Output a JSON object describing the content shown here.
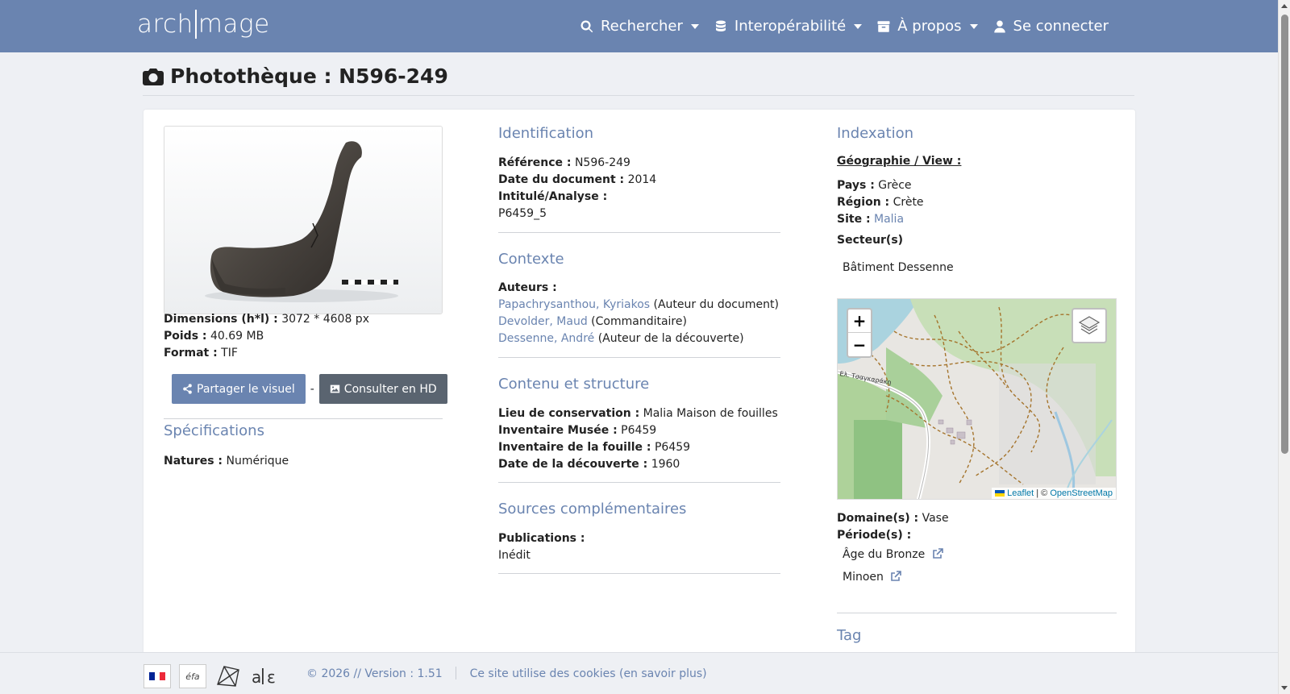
{
  "navbar": {
    "logo": "arch|mage",
    "logo_left": "arch",
    "logo_right": "mage",
    "items": [
      {
        "label": "Rechercher",
        "icon": "search-icon"
      },
      {
        "label": "Interopérabilité",
        "icon": "database-icon"
      },
      {
        "label": "À propos",
        "icon": "archive-icon"
      },
      {
        "label": "Se connecter",
        "icon": "user-icon"
      }
    ]
  },
  "page": {
    "title": "Photothèque : N596-249"
  },
  "left": {
    "dimensions_label": "Dimensions (h*l) :",
    "dimensions_value": "3072 * 4608 px",
    "poids_label": "Poids :",
    "poids_value": "40.69 MB",
    "format_label": "Format :",
    "format_value": "TIF",
    "share_button": "Partager le visuel",
    "separator": "-",
    "hd_button": "Consulter en HD",
    "specs_title": "Spécifications",
    "natures_label": "Natures :",
    "natures_value": "Numérique"
  },
  "identification": {
    "title": "Identification",
    "reference_label": "Référence :",
    "reference_value": "N596-249",
    "date_label": "Date du document :",
    "date_value": "2014",
    "intitule_label": "Intitulé/Analyse :",
    "intitule_value": "P6459_5"
  },
  "contexte": {
    "title": "Contexte",
    "auteurs_label": "Auteurs :",
    "authors": [
      {
        "name": "Papachrysanthou, Kyriakos",
        "role": "(Auteur du document)"
      },
      {
        "name": "Devolder, Maud",
        "role": "(Commanditaire)"
      },
      {
        "name": "Dessenne, André",
        "role": "(Auteur de la découverte)"
      }
    ]
  },
  "contenu": {
    "title": "Contenu et structure",
    "lieu_label": "Lieu de conservation :",
    "lieu_value": "Malia Maison de fouilles",
    "musee_label": "Inventaire Musée :",
    "musee_value": "P6459",
    "fouille_label": "Inventaire de la fouille :",
    "fouille_value": "P6459",
    "decouverte_label": "Date de la découverte :",
    "decouverte_value": "1960"
  },
  "sources": {
    "title": "Sources complémentaires",
    "publications_label": "Publications :",
    "publications_value": "Inédit"
  },
  "indexation": {
    "title": "Indexation",
    "geo_label": "Géographie / View :",
    "pays_label": "Pays :",
    "pays_value": "Grèce",
    "region_label": "Région :",
    "region_value": "Crète",
    "site_label": "Site :",
    "site_value": "Malia",
    "secteurs_label": "Secteur(s)",
    "secteur_value": "Bâtiment Dessenne",
    "map": {
      "zoom_in": "+",
      "zoom_out": "−",
      "attrib_leaflet": "Leaflet",
      "attrib_sep": "| ©",
      "attrib_osm": "OpenStreetMap",
      "road_label": "Ελ. Τσαγκαράκη"
    },
    "domaine_label": "Domaine(s) :",
    "domaine_value": "Vase",
    "periode_label": "Période(s) :",
    "periods": [
      "Âge du Bronze",
      "Minoen"
    ],
    "tag_title": "Tag"
  },
  "footer": {
    "copyright": "© 2026 // Version : 1.51",
    "cookies": "Ce site utilise des cookies (en savoir plus)",
    "logo_efa": "éfa"
  },
  "colors": {
    "brand": "#6a84b0",
    "button_dark": "#5a6470",
    "background": "#eef0f4"
  }
}
